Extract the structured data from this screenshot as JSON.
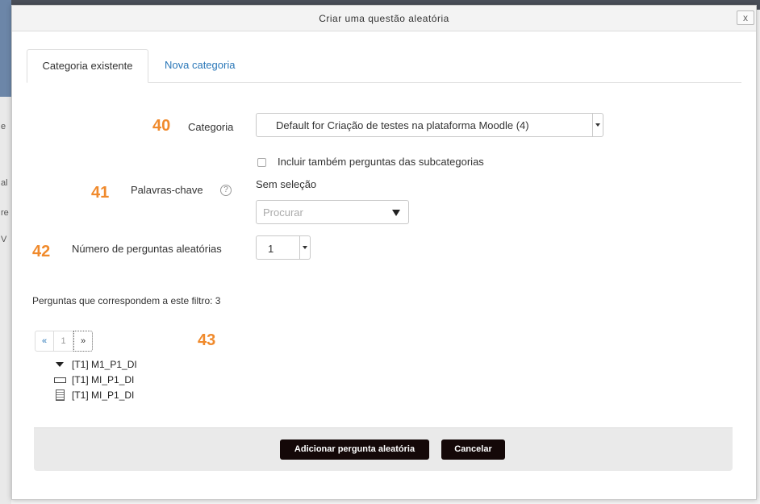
{
  "background": {
    "fragments": [
      "e",
      "al",
      "re",
      "V"
    ]
  },
  "dialog": {
    "title": "Criar uma questão aleatória",
    "close_label": "x"
  },
  "tabs": [
    {
      "label": "Categoria existente",
      "active": true
    },
    {
      "label": "Nova categoria",
      "active": false
    }
  ],
  "annotations": [
    "40",
    "41",
    "42",
    "43"
  ],
  "form": {
    "category": {
      "label": "Categoria",
      "value": "Default for Criação de testes na plataforma Moodle (4)"
    },
    "include_subcategories": {
      "label": "Incluir também perguntas das subcategorias",
      "checked": false
    },
    "keywords": {
      "label": "Palavras-chave",
      "help": "?",
      "selection_text": "Sem seleção",
      "search_placeholder": "Procurar"
    },
    "random_count": {
      "label": "Número de perguntas aleatórias",
      "value": "1"
    }
  },
  "filter_summary": "Perguntas que correspondem a este filtro: 3",
  "pager": {
    "first": "«",
    "current": "1",
    "next": "»"
  },
  "questions": [
    {
      "icon": "caret-down-icon",
      "label": "[T1] M1_P1_DI"
    },
    {
      "icon": "short-answer-icon",
      "label": "[T1] MI_P1_DI"
    },
    {
      "icon": "essay-icon",
      "label": "[T1] MI_P1_DI"
    }
  ],
  "buttons": {
    "add": "Adicionar pergunta aleatória",
    "cancel": "Cancelar"
  },
  "colors": {
    "annotation": "#f08a2c",
    "link": "#2a77b8",
    "button_bg": "#140808"
  }
}
